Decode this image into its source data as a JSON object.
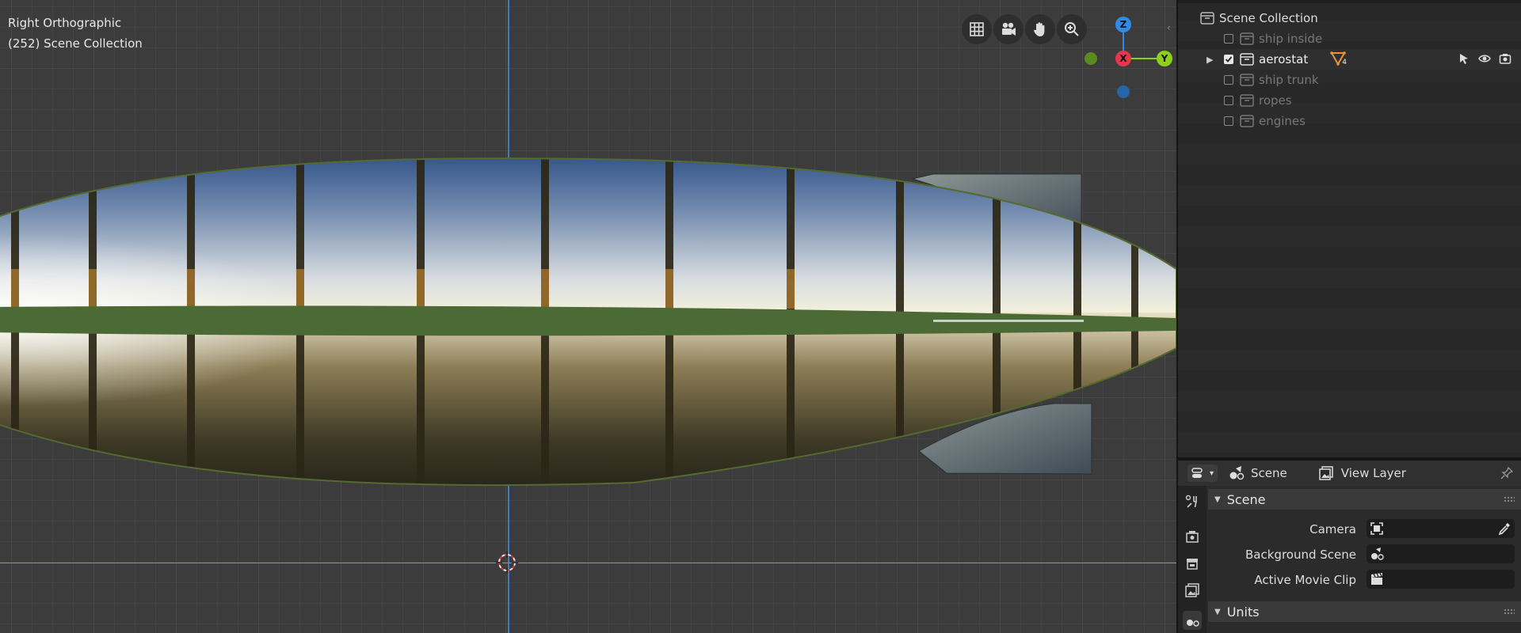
{
  "viewport": {
    "view_name": "Right Orthographic",
    "collection_info": "(252) Scene Collection",
    "gizmo": {
      "z": "Z",
      "x": "X",
      "y": "Y",
      "colors": {
        "x": "#e8364f",
        "y": "#8ccf1c",
        "z": "#2e8ce6"
      }
    },
    "nav_icons": [
      "grid-icon",
      "camera-icon",
      "hand-icon",
      "zoom-icon"
    ]
  },
  "outliner": {
    "root": "Scene Collection",
    "items": [
      {
        "label": "ship inside",
        "checked": false,
        "active": false
      },
      {
        "label": "aerostat",
        "checked": true,
        "active": true,
        "badge": "4"
      },
      {
        "label": "ship trunk",
        "checked": false,
        "active": false
      },
      {
        "label": "ropes",
        "checked": false,
        "active": false
      },
      {
        "label": "engines",
        "checked": false,
        "active": false
      }
    ]
  },
  "properties": {
    "header": {
      "scene_label": "Scene",
      "view_layer_label": "View Layer"
    },
    "panels": {
      "scene": {
        "title": "Scene",
        "camera_label": "Camera",
        "background_scene_label": "Background Scene",
        "active_clip_label": "Active Movie Clip"
      },
      "units": {
        "title": "Units"
      }
    }
  }
}
